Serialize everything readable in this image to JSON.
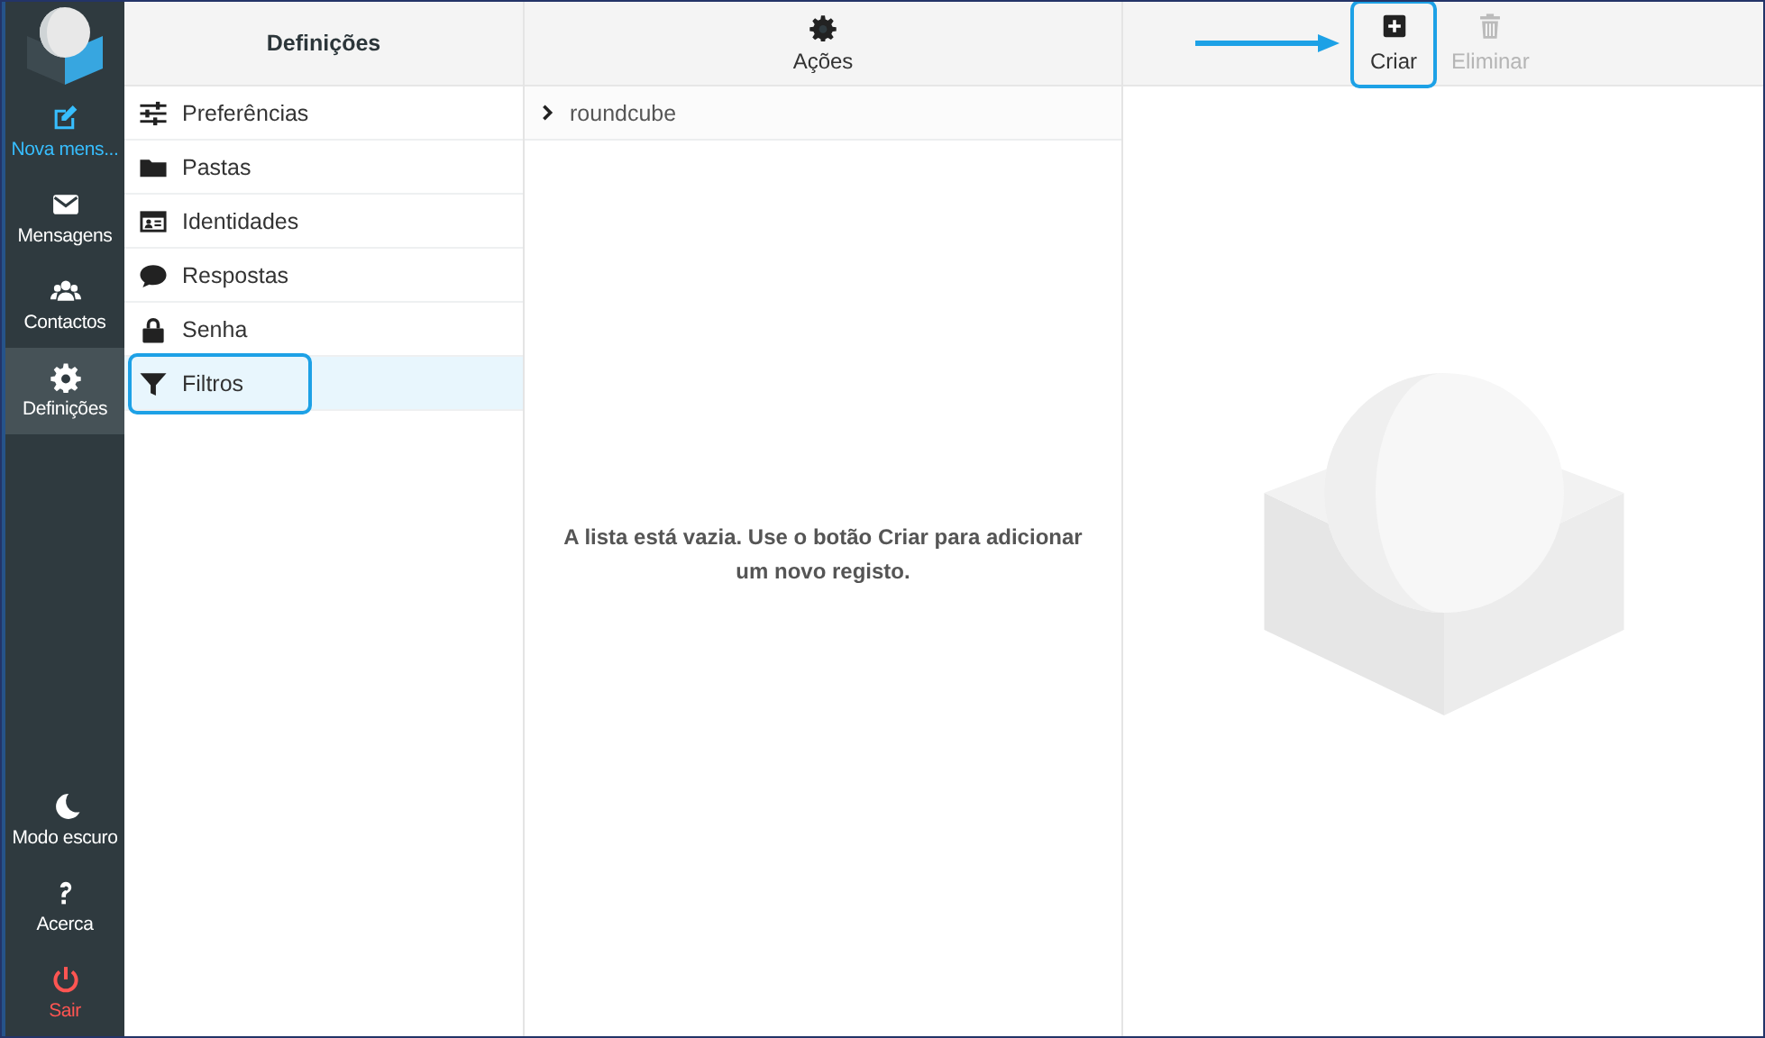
{
  "nav": [
    {
      "label": "Nova mens...",
      "kind": "compose",
      "selected": false
    },
    {
      "label": "Mensagens",
      "kind": "normal",
      "selected": false
    },
    {
      "label": "Contactos",
      "kind": "normal",
      "selected": false
    },
    {
      "label": "Definições",
      "kind": "normal",
      "selected": true
    }
  ],
  "nav_bottom": [
    {
      "label": "Modo escuro",
      "kind": "normal"
    },
    {
      "label": "Acerca",
      "kind": "normal"
    },
    {
      "label": "Sair",
      "kind": "logout"
    }
  ],
  "settings": {
    "title": "Definições",
    "items": [
      {
        "label": "Preferências",
        "selected": false,
        "highlighted": false
      },
      {
        "label": "Pastas",
        "selected": false,
        "highlighted": false
      },
      {
        "label": "Identidades",
        "selected": false,
        "highlighted": false
      },
      {
        "label": "Respostas",
        "selected": false,
        "highlighted": false
      },
      {
        "label": "Senha",
        "selected": false,
        "highlighted": false
      },
      {
        "label": "Filtros",
        "selected": true,
        "highlighted": true
      }
    ]
  },
  "filter_sets": {
    "actions_label": "Ações",
    "items": [
      {
        "label": "roundcube",
        "expanded": false
      }
    ]
  },
  "filters": {
    "empty_message": "A lista está vazia. Use o botão Criar para adicionar um novo registo."
  },
  "toolbar": [
    {
      "label": "Criar",
      "disabled": false,
      "highlighted": true,
      "pointer_arrow": true
    },
    {
      "label": "Eliminar",
      "disabled": true,
      "highlighted": false,
      "pointer_arrow": false
    }
  ]
}
